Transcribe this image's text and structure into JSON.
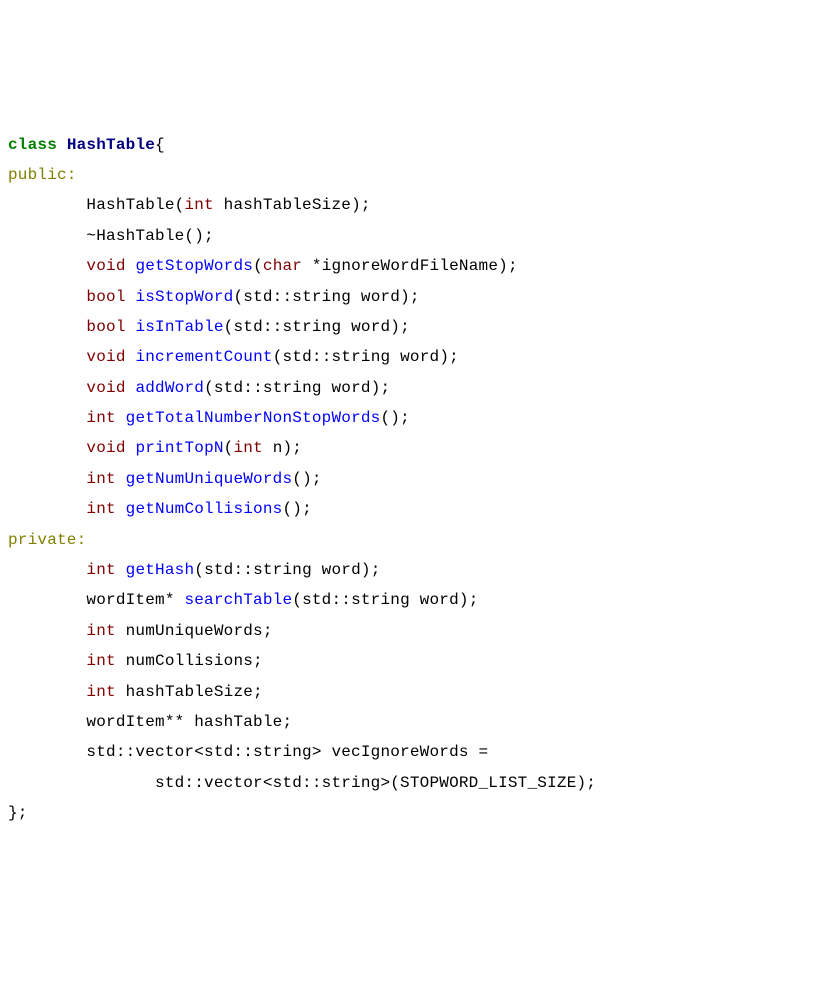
{
  "tokens": [
    {
      "cls": "kw-class",
      "txt": "class"
    },
    {
      "cls": "plain",
      "txt": " "
    },
    {
      "cls": "identifier-type",
      "txt": "HashTable"
    },
    {
      "cls": "punct",
      "txt": "{"
    },
    {
      "cls": "nl",
      "txt": "\n"
    },
    {
      "cls": "access-spec",
      "txt": "public:"
    },
    {
      "cls": "nl",
      "txt": "\n"
    },
    {
      "cls": "plain",
      "txt": "        HashTable("
    },
    {
      "cls": "kw-type",
      "txt": "int"
    },
    {
      "cls": "plain",
      "txt": " hashTableSize);"
    },
    {
      "cls": "nl",
      "txt": "\n"
    },
    {
      "cls": "plain",
      "txt": "        ~HashTable();"
    },
    {
      "cls": "nl",
      "txt": "\n"
    },
    {
      "cls": "plain",
      "txt": "        "
    },
    {
      "cls": "kw-type",
      "txt": "void"
    },
    {
      "cls": "plain",
      "txt": " "
    },
    {
      "cls": "func-name",
      "txt": "getStopWords"
    },
    {
      "cls": "punct",
      "txt": "("
    },
    {
      "cls": "kw-type",
      "txt": "char"
    },
    {
      "cls": "plain",
      "txt": " *ignoreWordFileName);"
    },
    {
      "cls": "nl",
      "txt": "\n"
    },
    {
      "cls": "plain",
      "txt": "        "
    },
    {
      "cls": "kw-type",
      "txt": "bool"
    },
    {
      "cls": "plain",
      "txt": " "
    },
    {
      "cls": "func-name",
      "txt": "isStopWord"
    },
    {
      "cls": "plain",
      "txt": "(std::string word);"
    },
    {
      "cls": "nl",
      "txt": "\n"
    },
    {
      "cls": "plain",
      "txt": "        "
    },
    {
      "cls": "kw-type",
      "txt": "bool"
    },
    {
      "cls": "plain",
      "txt": " "
    },
    {
      "cls": "func-name",
      "txt": "isInTable"
    },
    {
      "cls": "plain",
      "txt": "(std::string word);"
    },
    {
      "cls": "nl",
      "txt": "\n"
    },
    {
      "cls": "plain",
      "txt": "        "
    },
    {
      "cls": "kw-type",
      "txt": "void"
    },
    {
      "cls": "plain",
      "txt": " "
    },
    {
      "cls": "func-name",
      "txt": "incrementCount"
    },
    {
      "cls": "plain",
      "txt": "(std::string word);"
    },
    {
      "cls": "nl",
      "txt": "\n"
    },
    {
      "cls": "plain",
      "txt": "        "
    },
    {
      "cls": "kw-type",
      "txt": "void"
    },
    {
      "cls": "plain",
      "txt": " "
    },
    {
      "cls": "func-name",
      "txt": "addWord"
    },
    {
      "cls": "plain",
      "txt": "(std::string word);"
    },
    {
      "cls": "nl",
      "txt": "\n"
    },
    {
      "cls": "plain",
      "txt": "        "
    },
    {
      "cls": "kw-type",
      "txt": "int"
    },
    {
      "cls": "plain",
      "txt": " "
    },
    {
      "cls": "func-name",
      "txt": "getTotalNumberNonStopWords"
    },
    {
      "cls": "plain",
      "txt": "();"
    },
    {
      "cls": "nl",
      "txt": "\n"
    },
    {
      "cls": "plain",
      "txt": "        "
    },
    {
      "cls": "kw-type",
      "txt": "void"
    },
    {
      "cls": "plain",
      "txt": " "
    },
    {
      "cls": "func-name",
      "txt": "printTopN"
    },
    {
      "cls": "punct",
      "txt": "("
    },
    {
      "cls": "kw-type",
      "txt": "int"
    },
    {
      "cls": "plain",
      "txt": " n);"
    },
    {
      "cls": "nl",
      "txt": "\n"
    },
    {
      "cls": "plain",
      "txt": "        "
    },
    {
      "cls": "kw-type",
      "txt": "int"
    },
    {
      "cls": "plain",
      "txt": " "
    },
    {
      "cls": "func-name",
      "txt": "getNumUniqueWords"
    },
    {
      "cls": "plain",
      "txt": "();"
    },
    {
      "cls": "nl",
      "txt": "\n"
    },
    {
      "cls": "plain",
      "txt": "        "
    },
    {
      "cls": "kw-type",
      "txt": "int"
    },
    {
      "cls": "plain",
      "txt": " "
    },
    {
      "cls": "func-name",
      "txt": "getNumCollisions"
    },
    {
      "cls": "plain",
      "txt": "();"
    },
    {
      "cls": "nl",
      "txt": "\n"
    },
    {
      "cls": "access-spec",
      "txt": "private:"
    },
    {
      "cls": "nl",
      "txt": "\n"
    },
    {
      "cls": "plain",
      "txt": "        "
    },
    {
      "cls": "kw-type",
      "txt": "int"
    },
    {
      "cls": "plain",
      "txt": " "
    },
    {
      "cls": "func-name",
      "txt": "getHash"
    },
    {
      "cls": "plain",
      "txt": "(std::string word);"
    },
    {
      "cls": "nl",
      "txt": "\n"
    },
    {
      "cls": "plain",
      "txt": "        wordItem* "
    },
    {
      "cls": "func-name",
      "txt": "searchTable"
    },
    {
      "cls": "plain",
      "txt": "(std::string word);"
    },
    {
      "cls": "nl",
      "txt": "\n"
    },
    {
      "cls": "plain",
      "txt": "        "
    },
    {
      "cls": "kw-type",
      "txt": "int"
    },
    {
      "cls": "plain",
      "txt": " numUniqueWords;"
    },
    {
      "cls": "nl",
      "txt": "\n"
    },
    {
      "cls": "plain",
      "txt": "        "
    },
    {
      "cls": "kw-type",
      "txt": "int"
    },
    {
      "cls": "plain",
      "txt": " numCollisions;"
    },
    {
      "cls": "nl",
      "txt": "\n"
    },
    {
      "cls": "plain",
      "txt": "        "
    },
    {
      "cls": "kw-type",
      "txt": "int"
    },
    {
      "cls": "plain",
      "txt": " hashTableSize;"
    },
    {
      "cls": "nl",
      "txt": "\n"
    },
    {
      "cls": "plain",
      "txt": "        wordItem** hashTable;"
    },
    {
      "cls": "nl",
      "txt": "\n"
    },
    {
      "cls": "plain",
      "txt": "        std::vector<std::string> vecIgnoreWords ="
    },
    {
      "cls": "nl",
      "txt": "\n"
    },
    {
      "cls": "plain",
      "txt": "               std::vector<std::string>(STOPWORD_LIST_SIZE);"
    },
    {
      "cls": "nl",
      "txt": "\n"
    },
    {
      "cls": "plain",
      "txt": "};"
    }
  ]
}
